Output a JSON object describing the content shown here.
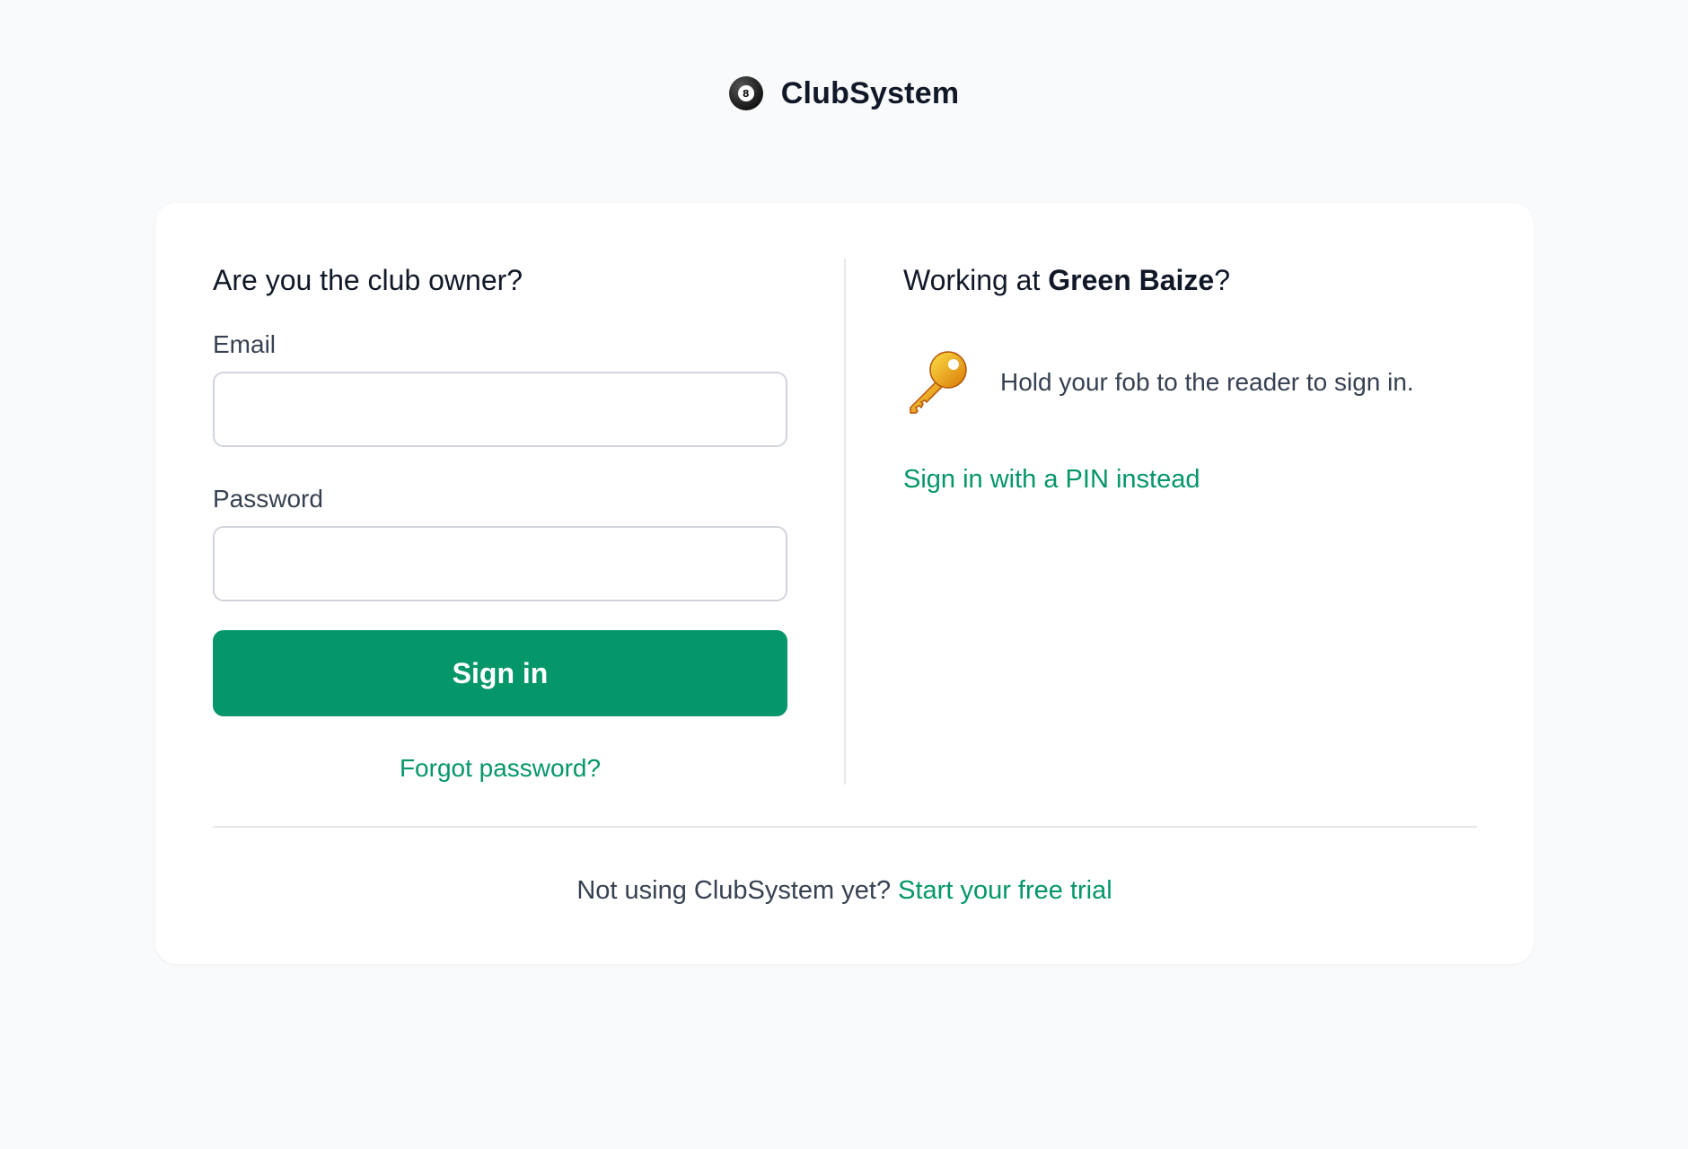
{
  "brand": {
    "name": "ClubSystem",
    "logo_icon": "eight-ball-icon",
    "logo_number": "8"
  },
  "owner_login": {
    "heading": "Are you the club owner?",
    "email_label": "Email",
    "email_value": "",
    "password_label": "Password",
    "password_value": "",
    "submit_label": "Sign in",
    "forgot_label": "Forgot password?"
  },
  "staff_login": {
    "heading_prefix": "Working at ",
    "club_name": "Green Baize",
    "heading_suffix": "?",
    "fob_icon": "key-icon",
    "fob_text": "Hold your fob to the reader to sign in.",
    "pin_link": "Sign in with a PIN instead"
  },
  "footer": {
    "text": "Not using ClubSystem yet?",
    "link": "Start your free trial"
  },
  "colors": {
    "accent": "#059669",
    "background": "#f9fafb",
    "card": "#ffffff",
    "text": "#111827",
    "muted_text": "#374151",
    "border": "#d1d5db"
  }
}
